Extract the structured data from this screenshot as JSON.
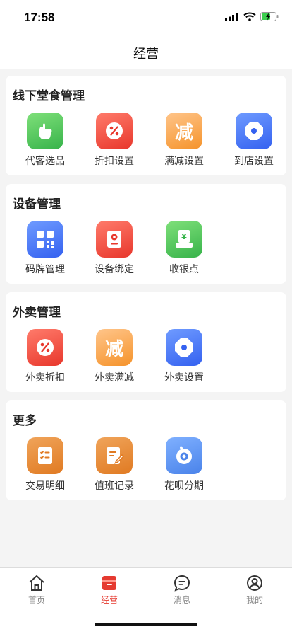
{
  "status": {
    "time": "17:58"
  },
  "nav": {
    "title": "经营"
  },
  "sections": [
    {
      "title": "线下堂食管理",
      "items": [
        {
          "label": "代客选品",
          "icon": "hand-pointer-icon",
          "color": "#4cc35a"
        },
        {
          "label": "折扣设置",
          "icon": "percent-icon",
          "color": "#ef4a3a"
        },
        {
          "label": "满减设置",
          "icon": "discount-reduce-icon",
          "color": "#f5a04a",
          "glyph": "减"
        },
        {
          "label": "到店设置",
          "icon": "settings-octagon-icon",
          "color": "#3f6cf4"
        }
      ]
    },
    {
      "title": "设备管理",
      "items": [
        {
          "label": "码牌管理",
          "icon": "qr-code-icon",
          "color": "#3f6cf4"
        },
        {
          "label": "设备绑定",
          "icon": "device-icon",
          "color": "#ef4a3a"
        },
        {
          "label": "收银点",
          "icon": "cashier-icon",
          "color": "#4cc35a",
          "glyph": "¥"
        }
      ]
    },
    {
      "title": "外卖管理",
      "items": [
        {
          "label": "外卖折扣",
          "icon": "percent-icon",
          "color": "#ef4a3a"
        },
        {
          "label": "外卖满减",
          "icon": "discount-reduce-icon",
          "color": "#f5a04a",
          "glyph": "减"
        },
        {
          "label": "外卖设置",
          "icon": "settings-octagon-icon",
          "color": "#3f6cf4"
        }
      ]
    },
    {
      "title": "更多",
      "items": [
        {
          "label": "交易明细",
          "icon": "checklist-icon",
          "color": "#e68a3a"
        },
        {
          "label": "值班记录",
          "icon": "edit-note-icon",
          "color": "#e68a3a"
        },
        {
          "label": "花呗分期",
          "icon": "huabei-icon",
          "color": "#4a83ea"
        }
      ]
    }
  ],
  "tabs": [
    {
      "label": "首页",
      "icon": "home-icon"
    },
    {
      "label": "经营",
      "icon": "store-box-icon",
      "active": true,
      "color": "#e53a30"
    },
    {
      "label": "消息",
      "icon": "message-icon"
    },
    {
      "label": "我的",
      "icon": "user-icon"
    }
  ]
}
